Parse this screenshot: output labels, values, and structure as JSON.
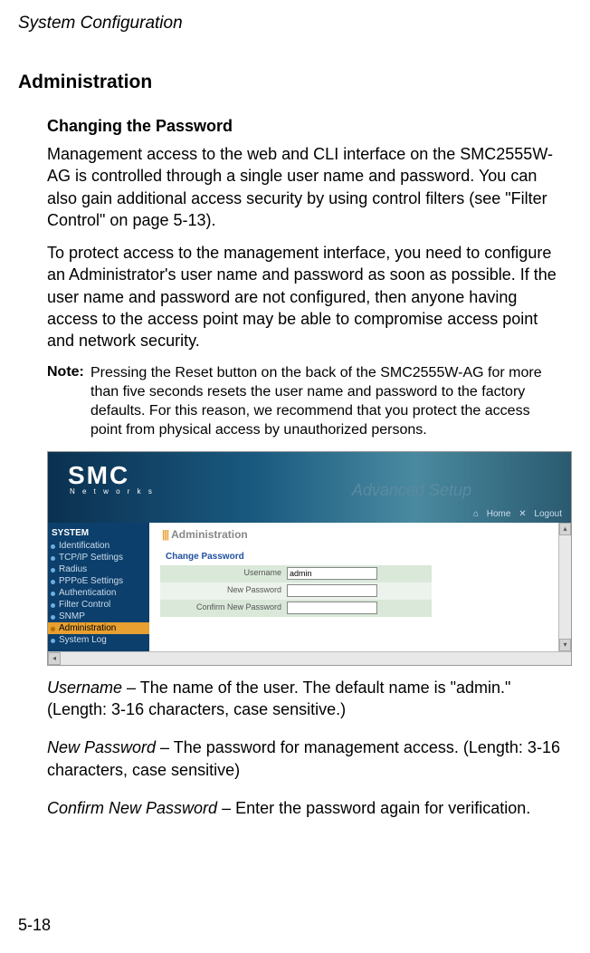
{
  "header_title": "System Configuration",
  "section_heading": "Administration",
  "sub_heading": "Changing the Password",
  "paragraph1": "Management access to the web and CLI interface on the SMC2555W-AG is controlled through a single user name and password. You can also gain additional access security by using control filters (see \"Filter Control\" on page 5-13).",
  "paragraph2": "To protect access to the management interface, you need to configure an Administrator's user name and password as soon as possible. If the user name and password are not configured, then anyone having access to the access point may be able to compromise access point and network security.",
  "note_label": "Note:",
  "note_text": "Pressing the Reset button on the back of the SMC2555W-AG for more than five seconds resets the user name and password to the factory defaults. For this reason, we recommend that you protect the access point from physical access by unauthorized persons.",
  "screenshot": {
    "logo": "SMC",
    "logo_sub": "N e t w o r k s",
    "banner": "Advanced Setup",
    "toplinks": {
      "home": "Home",
      "logout": "Logout"
    },
    "sidebar_header": "SYSTEM",
    "sidebar": [
      {
        "label": "Identification",
        "active": false
      },
      {
        "label": "TCP/IP Settings",
        "active": false
      },
      {
        "label": "Radius",
        "active": false
      },
      {
        "label": "PPPoE Settings",
        "active": false
      },
      {
        "label": "Authentication",
        "active": false
      },
      {
        "label": "Filter Control",
        "active": false
      },
      {
        "label": "SNMP",
        "active": false
      },
      {
        "label": "Administration",
        "active": true
      },
      {
        "label": "System Log",
        "active": false
      }
    ],
    "main_heading": "Administration",
    "sub_heading": "Change Password",
    "fields": {
      "username_label": "Username",
      "username_value": "admin",
      "newpw_label": "New Password",
      "newpw_value": "",
      "confirm_label": "Confirm New Password",
      "confirm_value": ""
    }
  },
  "field_username_name": "Username",
  "field_username_desc": " – The name of the user. The default name is \"admin.\" (Length: 3-16 characters, case sensitive.)",
  "field_newpw_name": "New Password",
  "field_newpw_desc": " – The password for management access. (Length: 3-16 characters, case sensitive)",
  "field_confirm_name": "Confirm New Password",
  "field_confirm_desc": " – Enter the password again for verification.",
  "page_number": "5-18"
}
